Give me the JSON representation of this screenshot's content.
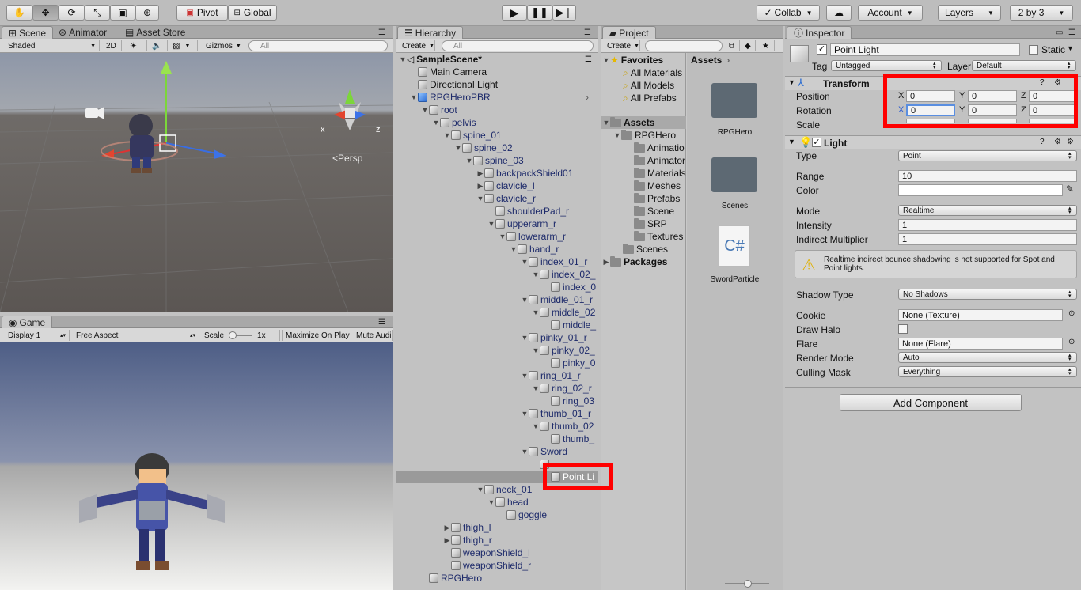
{
  "toolbar": {
    "pivot_label": "Pivot",
    "global_label": "Global",
    "collab_label": "Collab",
    "account_label": "Account",
    "layers_label": "Layers",
    "layout_label": "2 by 3"
  },
  "scene": {
    "tabs": [
      "Scene",
      "Animator",
      "Asset Store"
    ],
    "shading": "Shaded",
    "mode_2d": "2D",
    "gizmos": "Gizmos",
    "search_placeholder": "All",
    "persp_label": "Persp",
    "axis_x": "x",
    "axis_z": "z"
  },
  "game": {
    "tab": "Game",
    "display": "Display 1",
    "aspect": "Free Aspect",
    "scale_label": "Scale",
    "scale_value": "1x",
    "maximize": "Maximize On Play",
    "mute": "Mute Audi"
  },
  "hierarchy": {
    "tab": "Hierarchy",
    "create": "Create",
    "search_placeholder": "All",
    "scene_name": "SampleScene*",
    "items": [
      {
        "label": "Main Camera",
        "depth": 1,
        "arrow": ""
      },
      {
        "label": "Directional Light",
        "depth": 1,
        "arrow": ""
      },
      {
        "label": "RPGHeroPBR",
        "depth": 1,
        "arrow": "▼"
      },
      {
        "label": "root",
        "depth": 2,
        "arrow": "▼"
      },
      {
        "label": "pelvis",
        "depth": 3,
        "arrow": "▼"
      },
      {
        "label": "spine_01",
        "depth": 4,
        "arrow": "▼"
      },
      {
        "label": "spine_02",
        "depth": 5,
        "arrow": "▼"
      },
      {
        "label": "spine_03",
        "depth": 6,
        "arrow": "▼"
      },
      {
        "label": "backpackShield01",
        "depth": 7,
        "arrow": "▶"
      },
      {
        "label": "clavicle_l",
        "depth": 7,
        "arrow": "▶"
      },
      {
        "label": "clavicle_r",
        "depth": 7,
        "arrow": "▼"
      },
      {
        "label": "shoulderPad_r",
        "depth": 8,
        "arrow": ""
      },
      {
        "label": "upperarm_r",
        "depth": 8,
        "arrow": "▼"
      },
      {
        "label": "lowerarm_r",
        "depth": 9,
        "arrow": "▼"
      },
      {
        "label": "hand_r",
        "depth": 10,
        "arrow": "▼"
      },
      {
        "label": "index_01_r",
        "depth": 11,
        "arrow": "▼"
      },
      {
        "label": "index_02_",
        "depth": 12,
        "arrow": "▼"
      },
      {
        "label": "index_0",
        "depth": 13,
        "arrow": ""
      },
      {
        "label": "middle_01_r",
        "depth": 11,
        "arrow": "▼"
      },
      {
        "label": "middle_02",
        "depth": 12,
        "arrow": "▼"
      },
      {
        "label": "middle_",
        "depth": 13,
        "arrow": ""
      },
      {
        "label": "pinky_01_r",
        "depth": 11,
        "arrow": "▼"
      },
      {
        "label": "pinky_02_",
        "depth": 12,
        "arrow": "▼"
      },
      {
        "label": "pinky_0",
        "depth": 13,
        "arrow": ""
      },
      {
        "label": "ring_01_r",
        "depth": 11,
        "arrow": "▼"
      },
      {
        "label": "ring_02_r",
        "depth": 12,
        "arrow": "▼"
      },
      {
        "label": "ring_03",
        "depth": 13,
        "arrow": ""
      },
      {
        "label": "thumb_01_r",
        "depth": 11,
        "arrow": "▼"
      },
      {
        "label": "thumb_02",
        "depth": 12,
        "arrow": "▼"
      },
      {
        "label": "thumb_",
        "depth": 13,
        "arrow": ""
      },
      {
        "label": "Sword",
        "depth": 11,
        "arrow": "▼"
      },
      {
        "label": "",
        "depth": 12,
        "arrow": ""
      },
      {
        "label": "Point Li",
        "depth": 13,
        "arrow": "",
        "selected": true
      },
      {
        "label": "neck_01",
        "depth": 7,
        "arrow": "▼"
      },
      {
        "label": "head",
        "depth": 8,
        "arrow": "▼"
      },
      {
        "label": "goggle",
        "depth": 9,
        "arrow": ""
      },
      {
        "label": "thigh_l",
        "depth": 4,
        "arrow": "▶"
      },
      {
        "label": "thigh_r",
        "depth": 4,
        "arrow": "▶"
      },
      {
        "label": "weaponShield_l",
        "depth": 4,
        "arrow": ""
      },
      {
        "label": "weaponShield_r",
        "depth": 4,
        "arrow": ""
      },
      {
        "label": "RPGHero",
        "depth": 2,
        "arrow": ""
      }
    ]
  },
  "project": {
    "tab": "Project",
    "create": "Create",
    "favorites_label": "Favorites",
    "favorites": [
      "All Materials",
      "All Models",
      "All Prefabs"
    ],
    "assets_label": "Assets",
    "rpghero_label": "RPGHero",
    "rpghero_children": [
      "Animatio",
      "Animator",
      "Materials",
      "Meshes",
      "Prefabs",
      "Scene",
      "SRP",
      "Textures"
    ],
    "scenes_label": "Scenes",
    "packages_label": "Packages",
    "breadcrumb": "Assets",
    "grid_items": [
      {
        "label": "RPGHero",
        "kind": "folder"
      },
      {
        "label": "Scenes",
        "kind": "folder"
      },
      {
        "label": "SwordParticle",
        "kind": "script",
        "glyph": "C#"
      }
    ]
  },
  "inspector": {
    "tab": "Inspector",
    "object_name": "Point Light",
    "static_label": "Static",
    "tag_label": "Tag",
    "tag_value": "Untagged",
    "layer_label": "Layer",
    "layer_value": "Default",
    "transform": {
      "title": "Transform",
      "position_label": "Position",
      "rotation_label": "Rotation",
      "scale_label": "Scale",
      "x_label": "X",
      "y_label": "Y",
      "z_label": "Z",
      "pos_x": "0",
      "pos_y": "0",
      "pos_z": "0",
      "rot_x": "0",
      "rot_y": "0",
      "rot_z": "0"
    },
    "light": {
      "title": "Light",
      "type_label": "Type",
      "type_value": "Point",
      "range_label": "Range",
      "range_value": "10",
      "color_label": "Color",
      "mode_label": "Mode",
      "mode_value": "Realtime",
      "intensity_label": "Intensity",
      "intensity_value": "1",
      "indirect_label": "Indirect Multiplier",
      "indirect_value": "1",
      "warning": "Realtime indirect bounce shadowing is not supported for Spot and Point lights.",
      "shadow_label": "Shadow Type",
      "shadow_value": "No Shadows",
      "cookie_label": "Cookie",
      "cookie_value": "None (Texture)",
      "halo_label": "Draw Halo",
      "flare_label": "Flare",
      "flare_value": "None (Flare)",
      "render_label": "Render Mode",
      "render_value": "Auto",
      "cull_label": "Culling Mask",
      "cull_value": "Everything"
    },
    "add_component": "Add Component"
  },
  "colors": {
    "highlight": "#ff0000",
    "sky": "#5d6f98",
    "ground": "#5a5552",
    "tree_text": "#1d2a6a"
  }
}
